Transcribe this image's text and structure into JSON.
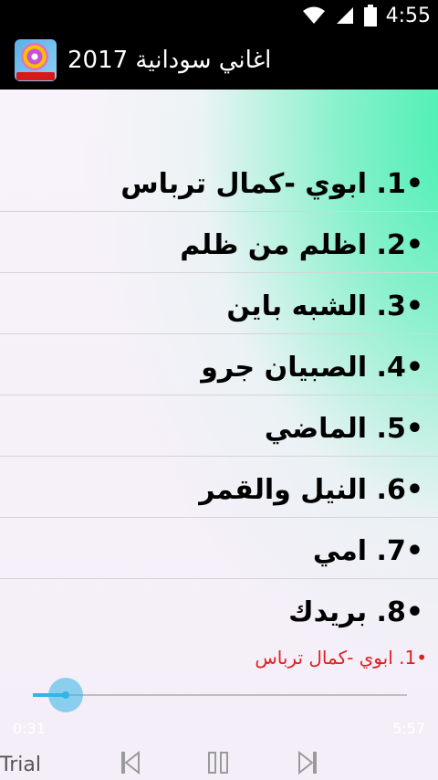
{
  "status_bar": {
    "time": "4:55"
  },
  "action_bar": {
    "title": "اغاني سودانية 2017"
  },
  "songs": [
    {
      "label": "•1. ابوي -كمال ترباس"
    },
    {
      "label": "•2. اظلم من ظلم"
    },
    {
      "label": "•3. الشبه باين"
    },
    {
      "label": "•4. الصبيان جرو"
    },
    {
      "label": "•5. الماضي"
    },
    {
      "label": "•6. النيل والقمر"
    },
    {
      "label": "•7. امي"
    },
    {
      "label": "•8. بريدك"
    }
  ],
  "player": {
    "now_playing": "•1. ابوي -كمال ترباس",
    "current_time": "0:31",
    "total_time": "5:57",
    "progress": 0.087,
    "trial_label": "Trial"
  },
  "colors": {
    "accent": "#33b5e5",
    "now_playing": "#e02020",
    "gradient_green": "#34f0aa"
  },
  "icons": [
    "wifi-icon",
    "signal-icon",
    "battery-icon",
    "previous-icon",
    "pause-icon",
    "next-icon"
  ]
}
